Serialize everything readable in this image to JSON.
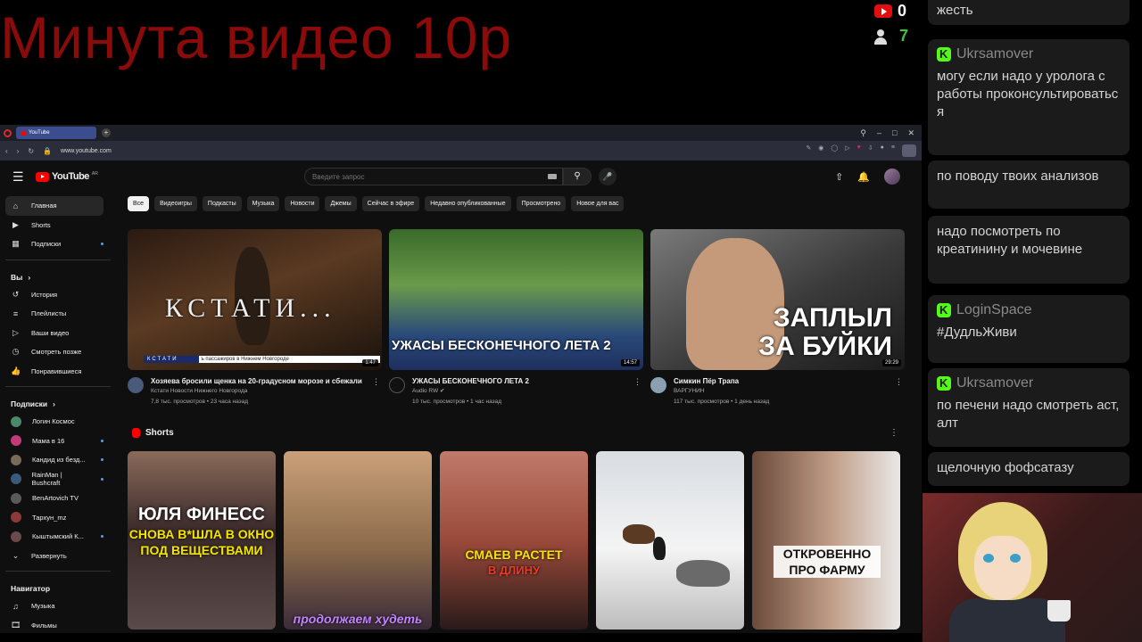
{
  "overlay": {
    "title": "Минута видео 10р",
    "youtube_count": "0",
    "viewers_count": "7"
  },
  "browser": {
    "tab_title": "YouTube",
    "url": "www.youtube.com"
  },
  "yt": {
    "logo_text": "YouTube",
    "country": "AR",
    "search_placeholder": "Введите запрос"
  },
  "sidebar": {
    "main": [
      {
        "label": "Главная",
        "icon": "home-icon"
      },
      {
        "label": "Shorts",
        "icon": "shorts-icon"
      },
      {
        "label": "Подписки",
        "icon": "subscriptions-icon"
      }
    ],
    "you_heading": "Вы",
    "you": [
      {
        "label": "История",
        "icon": "history-icon"
      },
      {
        "label": "Плейлисты",
        "icon": "playlists-icon"
      },
      {
        "label": "Ваши видео",
        "icon": "your-videos-icon"
      },
      {
        "label": "Смотреть позже",
        "icon": "watch-later-icon"
      },
      {
        "label": "Понравившиеся",
        "icon": "liked-icon"
      }
    ],
    "subs_heading": "Подписки",
    "subs": [
      {
        "label": "Логин Космос",
        "color": "#4a8a6a"
      },
      {
        "label": "Мама в 16",
        "color": "#c23a7a"
      },
      {
        "label": "Кандид из безд...",
        "color": "#7a6a5a"
      },
      {
        "label": "RainMan | Bushcraft",
        "color": "#3a5a7a"
      },
      {
        "label": "BenArtovich TV",
        "color": "#5a5a5a"
      },
      {
        "label": "Тархун_mz",
        "color": "#8a3a3a"
      },
      {
        "label": "Кыштымский К...",
        "color": "#6a4a4a"
      }
    ],
    "expand_label": "Развернуть",
    "nav_heading": "Навигатор",
    "nav": [
      {
        "label": "Музыка",
        "icon": "music-icon"
      },
      {
        "label": "Фильмы",
        "icon": "movies-icon"
      }
    ]
  },
  "chips": [
    "Все",
    "Видеоигры",
    "Подкасты",
    "Музыка",
    "Новости",
    "Джемы",
    "Сейчас в эфире",
    "Недавно опубликованные",
    "Просмотрено",
    "Новое для вас"
  ],
  "videos": [
    {
      "thumb_text": "КСТАТИ...",
      "ticker_tag": "КСТАТИ",
      "ticker_text": "ъ пассажиров в Нижнем Новгороде",
      "duration": "1:47",
      "title": "Хозяева бросили щенка на 20-градусном морозе и сбежали",
      "channel": "Кстати Новости Нижнего Новгорода",
      "stats": "7,8 тыс. просмотров • 23 часа назад",
      "avatar_color": "#4a5a7a"
    },
    {
      "thumb_text": "УЖАСЫ БЕСКОНЕЧНОГО ЛЕТА 2",
      "duration": "14:57",
      "title": "УЖАСЫ БЕСКОНЕЧНОГО ЛЕТА 2",
      "channel": "Audio RW",
      "stats": "10 тыс. просмотров • 1 час назад",
      "avatar_color": "#111111"
    },
    {
      "thumb_text_1": "ЗАПЛЫЛ",
      "thumb_text_2": "ЗА БУЙКИ",
      "duration": "29:29",
      "title": "Симкин Пёр Трапа",
      "channel": "ВАРГУНИН",
      "stats": "117 тыс. просмотров • 1 день назад",
      "avatar_color": "#8aa0b0"
    }
  ],
  "shorts": {
    "heading": "Shorts",
    "items": [
      {
        "line1": "ЮЛЯ ФИНЕСС",
        "line2": "СНОВА В*ШЛА В ОКНО ПОД ВЕЩЕСТВАМИ"
      },
      {
        "line1": "продолжаем худеть"
      },
      {
        "line1": "СМАЕВ РАСТЕТ",
        "line2": "В ДЛИНУ"
      },
      {
        "line1": ""
      },
      {
        "line1": "ОТКРОВЕННО ПРО ФАРМУ"
      }
    ]
  },
  "chat": [
    {
      "user": "",
      "text": "жесть"
    },
    {
      "user": "Ukrsamover",
      "text": "могу если надо у уролога с работы проконсультироватьс я"
    },
    {
      "user": "",
      "text": "по поводу твоих анализов"
    },
    {
      "user": "",
      "text": "надо посмотреть по креатинину и мочевине"
    },
    {
      "user": "LoginSpace",
      "text": "#ДудльЖиви"
    },
    {
      "user": "Ukrsamover",
      "text": "по печени надо смотреть аст, алт"
    },
    {
      "user": "",
      "text": "щелочную фофсатазу"
    }
  ]
}
